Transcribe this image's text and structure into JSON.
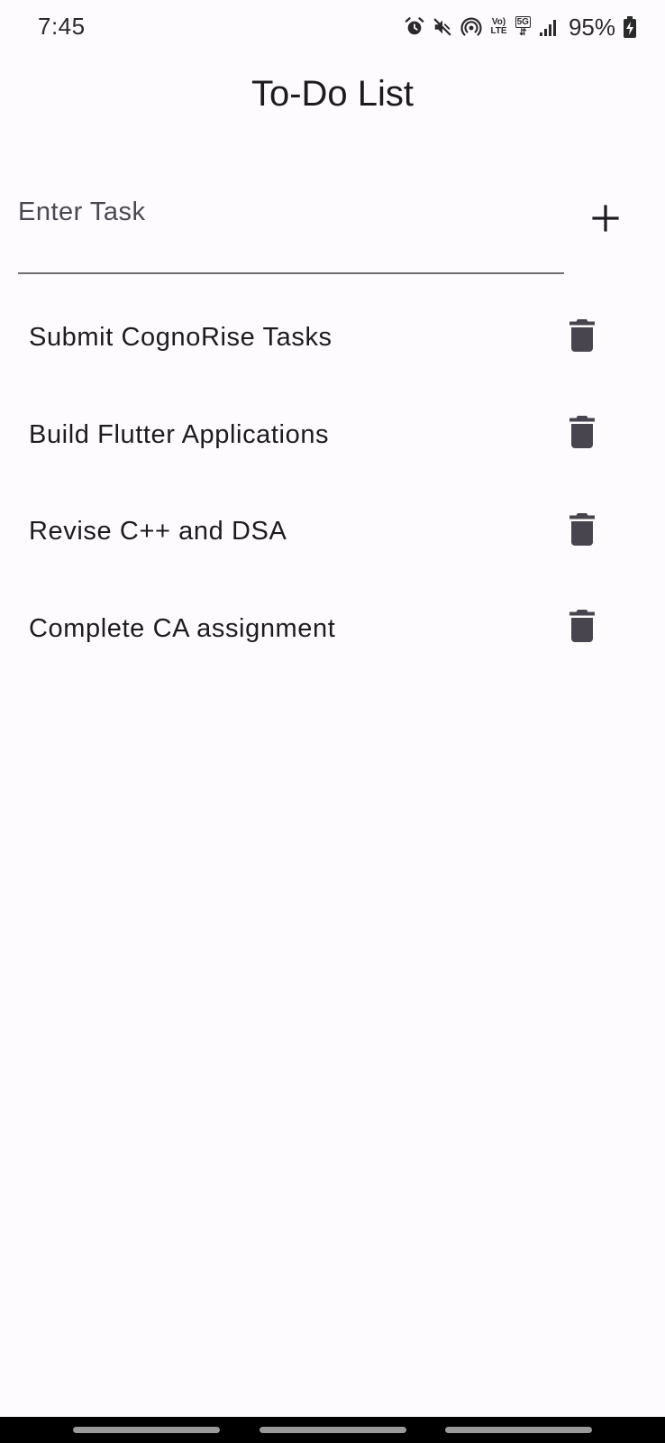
{
  "status_bar": {
    "time": "7:45",
    "battery": "95%",
    "volte_top": "Vo)",
    "volte_bottom": "LTE",
    "network": "5G",
    "icons": [
      "alarm-icon",
      "mute-icon",
      "hotspot-icon",
      "volte-icon",
      "5g-icon",
      "signal-icon",
      "battery-charging-icon"
    ]
  },
  "app_bar": {
    "title": "To-Do List"
  },
  "input": {
    "placeholder": "Enter Task",
    "value": "",
    "add_icon": "plus-icon"
  },
  "tasks": [
    {
      "label": "Submit CognoRise Tasks",
      "icon": "trash-icon"
    },
    {
      "label": "Build Flutter Applications",
      "icon": "trash-icon"
    },
    {
      "label": "Revise C++ and DSA",
      "icon": "trash-icon"
    },
    {
      "label": "Complete CA assignment",
      "icon": "trash-icon"
    }
  ],
  "colors": {
    "background": "#fefbfe",
    "text": "#1d1b20",
    "icon": "#49454f",
    "underline": "#6f6c73",
    "nav_bar": "#000000"
  }
}
